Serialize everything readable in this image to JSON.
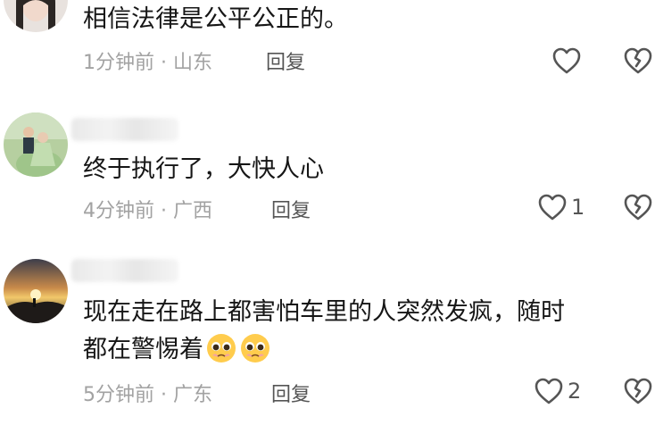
{
  "comments": [
    {
      "text": "相信法律是公平公正的。",
      "time": "1分钟前",
      "separator": "·",
      "location": "山东",
      "reply_label": "回复",
      "likes": "",
      "avatar": "girl-avatar"
    },
    {
      "text": "终于执行了，大快人心",
      "time": "4分钟前",
      "separator": "·",
      "location": "广西",
      "reply_label": "回复",
      "likes": "1",
      "avatar": "wedding-couple-avatar"
    },
    {
      "text": "现在走在路上都害怕车里的人突然发疯，随时",
      "text2": "都在警惕着",
      "emoji_names": [
        "pleading-face-emoji",
        "pleading-face-emoji"
      ],
      "time": "5分钟前",
      "separator": "·",
      "location": "广东",
      "reply_label": "回复",
      "likes": "2",
      "avatar": "sunset-mountain-avatar"
    }
  ],
  "icons": {
    "like": "heart-outline-icon",
    "dislike": "broken-heart-outline-icon"
  },
  "colors": {
    "text": "#161616",
    "meta": "#a2a2a2",
    "icon": "#555555"
  }
}
